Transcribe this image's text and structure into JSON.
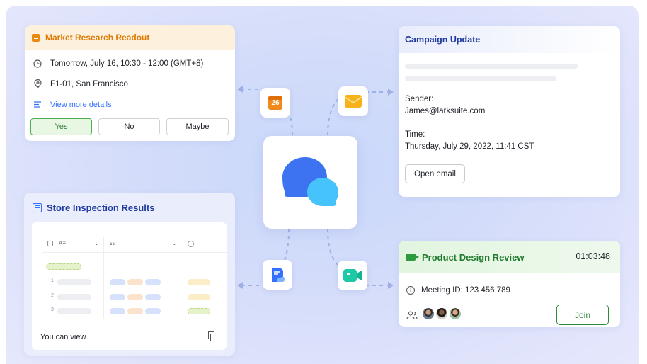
{
  "meeting_card": {
    "title": "Market Research Readout",
    "time": "Tomorrow, July 16, 10:30 - 12:00 (GMT+8)",
    "location": "F1-01, San Francisco",
    "details_link": "View more details",
    "buttons": {
      "yes": "Yes",
      "no": "No",
      "maybe": "Maybe"
    },
    "accent": "#de7a05"
  },
  "campaign_card": {
    "title": "Campaign Update",
    "sender_label": "Sender:",
    "sender": "James@larksuite.com",
    "time_label": "Time:",
    "time": "Thursday, July 29, 2022, 11:41 CST",
    "open_button": "Open email",
    "accent": "#1f3a9e"
  },
  "sheet_card": {
    "title": "Store Inspection Results",
    "row_numbers": [
      "1",
      "2",
      "3"
    ],
    "footer": "You can view"
  },
  "vc_card": {
    "title": "Product Design Review",
    "timer": "01:03:48",
    "meeting_id": "Meeting ID: 123 456 789",
    "join_button": "Join",
    "accent": "#217a2e"
  },
  "calendar_icon_day": "26",
  "icons": [
    "calendar-icon",
    "mail-icon",
    "docs-icon",
    "video-icon",
    "chat-bubbles-icon"
  ]
}
